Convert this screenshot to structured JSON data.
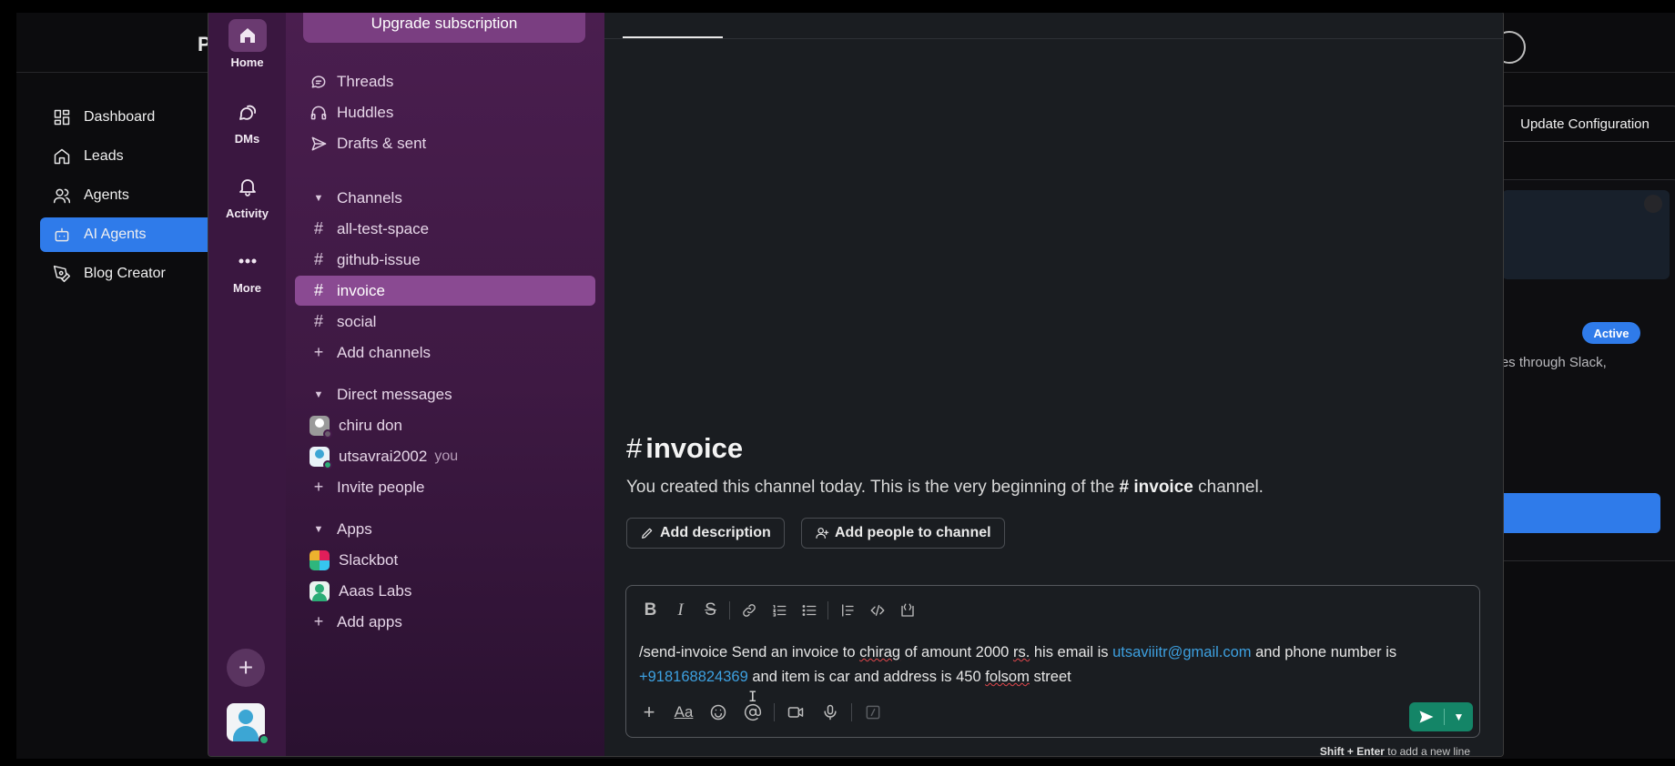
{
  "background_app": {
    "brand_initial": "P",
    "nav": [
      {
        "label": "Dashboard",
        "icon": "dashboard-icon"
      },
      {
        "label": "Leads",
        "icon": "home-icon"
      },
      {
        "label": "Agents",
        "icon": "users-icon"
      },
      {
        "label": "AI Agents",
        "icon": "bot-icon",
        "active": true
      },
      {
        "label": "Blog Creator",
        "icon": "pen-tool-icon"
      }
    ],
    "update_button": "Update Configuration",
    "status_badge": "Active",
    "card_description": "ices through Slack,"
  },
  "slack": {
    "rail": {
      "home": "Home",
      "dms": "DMs",
      "activity": "Activity",
      "more": "More"
    },
    "upgrade_label": "Upgrade subscription",
    "sidebar": {
      "threads": "Threads",
      "huddles": "Huddles",
      "drafts": "Drafts & sent",
      "channels_header": "Channels",
      "channels": [
        "all-test-space",
        "github-issue",
        "invoice",
        "social"
      ],
      "add_channels": "Add channels",
      "dm_header": "Direct messages",
      "dms": [
        {
          "name": "chiru don",
          "you": ""
        },
        {
          "name": "utsavrai2002",
          "you": "you"
        }
      ],
      "invite_people": "Invite people",
      "apps_header": "Apps",
      "apps": [
        "Slackbot",
        "Aaas Labs"
      ],
      "add_apps": "Add apps"
    },
    "channel": {
      "hash": "#",
      "name": "invoice",
      "intro_prefix": "You created this channel today. This is the very beginning of the",
      "intro_channel": "# invoice",
      "intro_suffix": "channel.",
      "add_description": "Add description",
      "add_people": "Add people to channel"
    },
    "composer": {
      "message": {
        "part1": "/send-invoice Send an invoice to ",
        "typo1": "chirag",
        "part2": " of amount 2000 ",
        "typo2": "rs.",
        "part3": " his email is ",
        "email": "utsaviiitr@gmail.com",
        "part4": " and phone number is",
        "phone": "+918168824369",
        "part5": " and item is car and address is 450 ",
        "typo3": "folsom",
        "part6": " street"
      },
      "hint_key": "Shift + Enter",
      "hint_text": "to add a new line"
    }
  }
}
